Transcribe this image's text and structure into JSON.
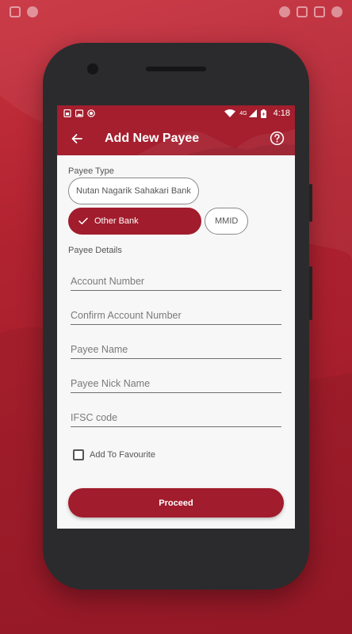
{
  "device_status": {
    "time": "4:18",
    "network": "4G"
  },
  "app_bar": {
    "title": "Add New Payee"
  },
  "payee_type": {
    "label": "Payee Type",
    "options": [
      {
        "label": "Nutan Nagarik Sahakari Bank",
        "selected": false
      },
      {
        "label": "Other Bank",
        "selected": true
      },
      {
        "label": "MMID",
        "selected": false
      }
    ]
  },
  "payee_details": {
    "label": "Payee Details",
    "fields": [
      {
        "placeholder": "Account Number",
        "value": ""
      },
      {
        "placeholder": "Confirm Account Number",
        "value": ""
      },
      {
        "placeholder": "Payee Name",
        "value": ""
      },
      {
        "placeholder": "Payee Nick Name",
        "value": ""
      },
      {
        "placeholder": "IFSC code",
        "value": ""
      }
    ]
  },
  "favourite": {
    "label": "Add To Favourite",
    "checked": false
  },
  "proceed_label": "Proceed",
  "colors": {
    "accent": "#a11c2c",
    "background": "#b0222f"
  },
  "icons": {
    "back": "arrow-left-icon",
    "help": "help-circle-icon",
    "check": "check-icon"
  }
}
